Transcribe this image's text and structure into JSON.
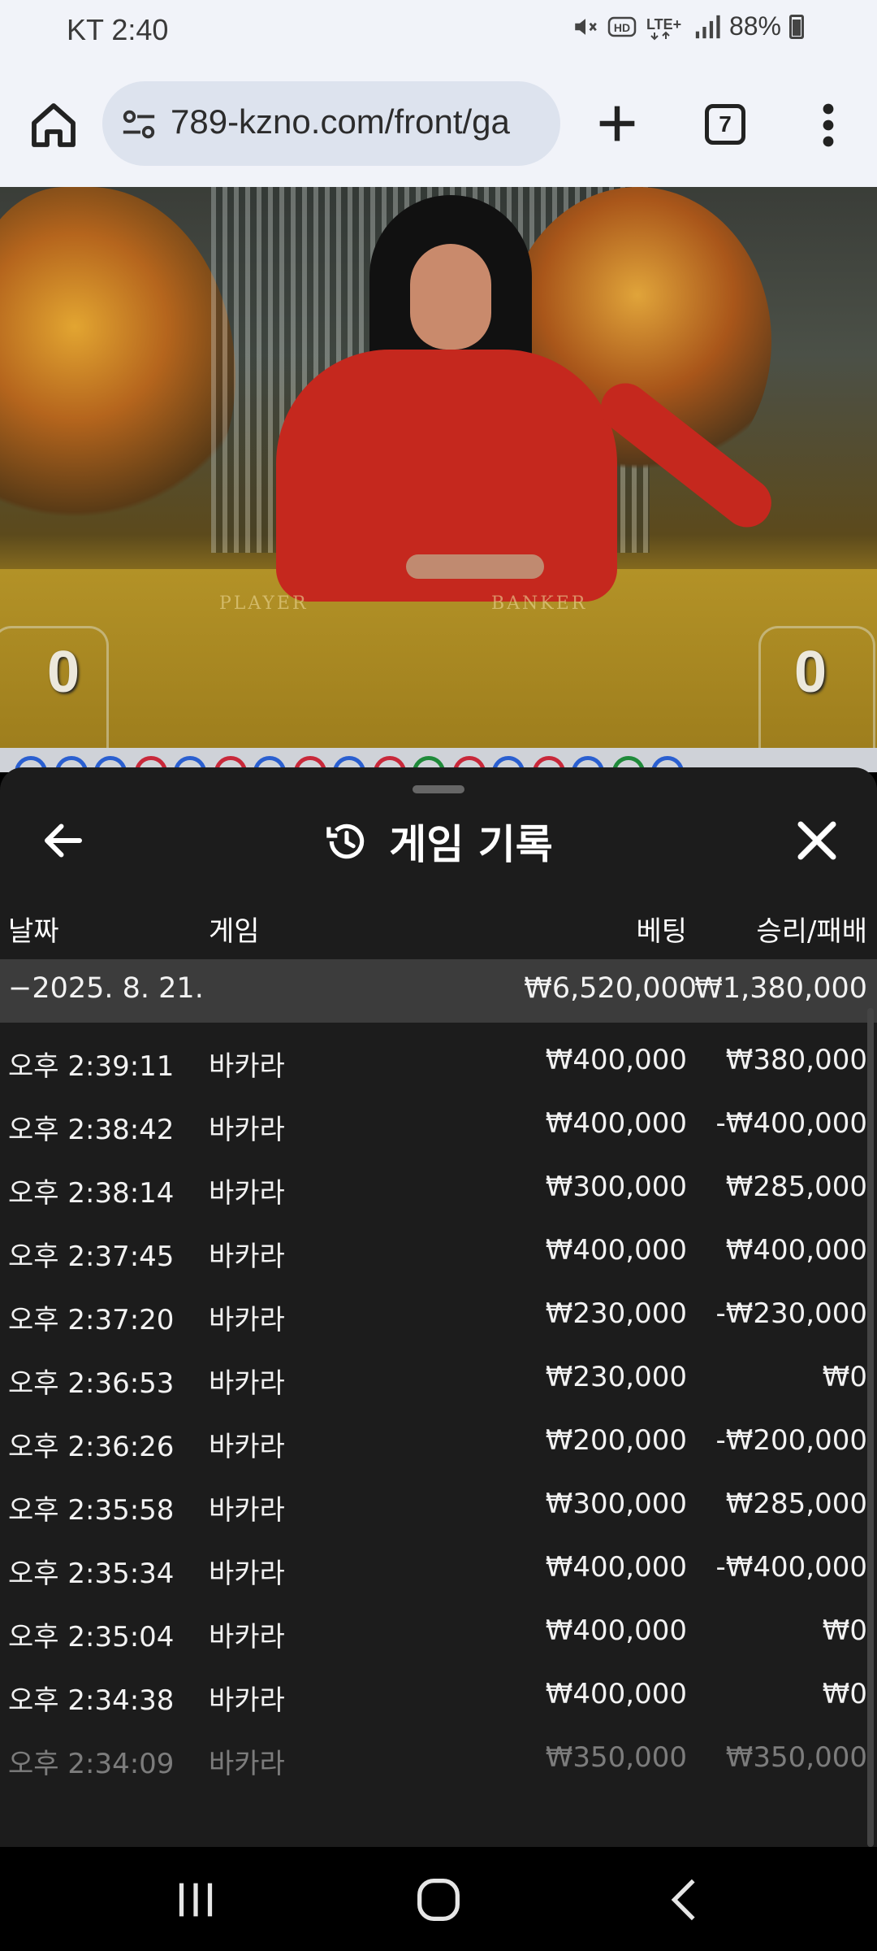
{
  "status_bar": {
    "time": "KT 2:40",
    "battery": "88%"
  },
  "browser": {
    "url": "789-kzno.com/front/ga",
    "tab_count": "7"
  },
  "video": {
    "table_labels": [
      "PLAYER",
      "BANKER"
    ],
    "player_score": "0",
    "banker_score": "0"
  },
  "history": {
    "title": "게임 기록",
    "columns": {
      "date": "날짜",
      "game": "게임",
      "bet": "베팅",
      "result": "승리/패배"
    },
    "summary": {
      "date": "−2025. 8. 21.",
      "bet": "₩6,520,000",
      "result": "₩1,380,000"
    },
    "rows": [
      {
        "time": "오후 2:39:11",
        "game": "바카라",
        "bet": "₩400,000",
        "result": "₩380,000"
      },
      {
        "time": "오후 2:38:42",
        "game": "바카라",
        "bet": "₩400,000",
        "result": "-₩400,000"
      },
      {
        "time": "오후 2:38:14",
        "game": "바카라",
        "bet": "₩300,000",
        "result": "₩285,000"
      },
      {
        "time": "오후 2:37:45",
        "game": "바카라",
        "bet": "₩400,000",
        "result": "₩400,000"
      },
      {
        "time": "오후 2:37:20",
        "game": "바카라",
        "bet": "₩230,000",
        "result": "-₩230,000"
      },
      {
        "time": "오후 2:36:53",
        "game": "바카라",
        "bet": "₩230,000",
        "result": "₩0"
      },
      {
        "time": "오후 2:36:26",
        "game": "바카라",
        "bet": "₩200,000",
        "result": "-₩200,000"
      },
      {
        "time": "오후 2:35:58",
        "game": "바카라",
        "bet": "₩300,000",
        "result": "₩285,000"
      },
      {
        "time": "오후 2:35:34",
        "game": "바카라",
        "bet": "₩400,000",
        "result": "-₩400,000"
      },
      {
        "time": "오후 2:35:04",
        "game": "바카라",
        "bet": "₩400,000",
        "result": "₩0"
      },
      {
        "time": "오후 2:34:38",
        "game": "바카라",
        "bet": "₩400,000",
        "result": "₩0"
      },
      {
        "time": "오후 2:34:09",
        "game": "바카라",
        "bet": "₩350,000",
        "result": "₩350,000"
      }
    ]
  }
}
